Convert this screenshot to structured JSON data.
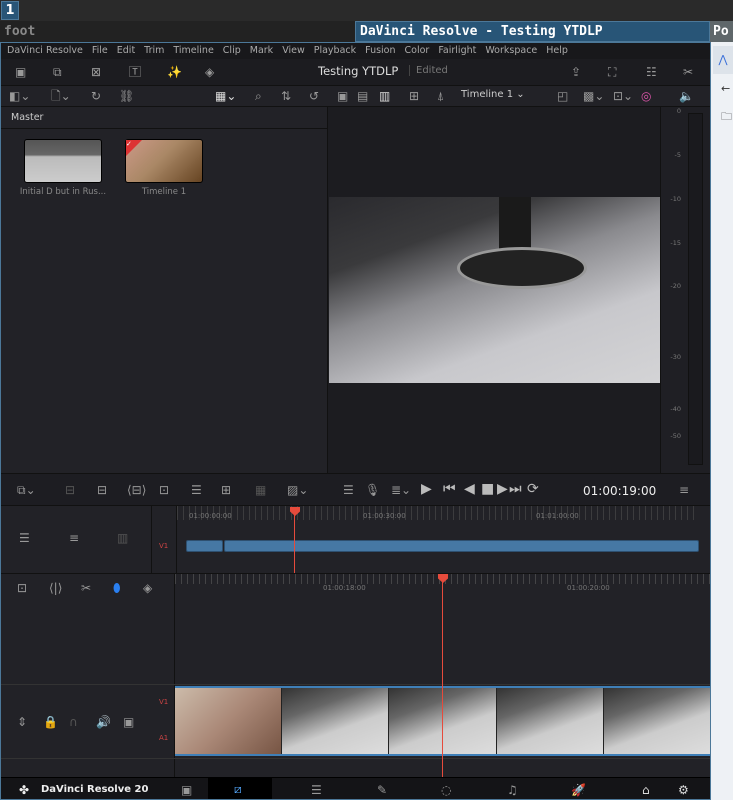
{
  "workspace": {
    "number": "1"
  },
  "titles": {
    "left": "foot",
    "main": "DaVinci Resolve - Testing YTDLP",
    "right": "Po"
  },
  "menu": [
    "DaVinci Resolve",
    "File",
    "Edit",
    "Trim",
    "Timeline",
    "Clip",
    "Mark",
    "View",
    "Playback",
    "Fusion",
    "Color",
    "Fairlight",
    "Workspace",
    "Help"
  ],
  "project": {
    "title": "Testing YTDLP",
    "status": "Edited"
  },
  "viewer": {
    "timeline_select": "Timeline 1",
    "timecode": "01:00:19:00"
  },
  "pool": {
    "bin": "Master",
    "clips": [
      {
        "name": "Initial D but in Rus..."
      },
      {
        "name": "Timeline 1"
      }
    ]
  },
  "meter": {
    "ticks": [
      "0",
      "-5",
      "-10",
      "-15",
      "-20",
      "-30",
      "-40",
      "-50"
    ]
  },
  "upper_timeline": {
    "ticks": [
      "01:00:00:00",
      "01:00:30:00",
      "01:01:00:00"
    ],
    "track": "V1",
    "playhead_fraction": 0.21
  },
  "lower_timeline": {
    "ticks": [
      "01:00:18:00",
      "01:00:20:00"
    ],
    "video_track": "V1",
    "audio_track": "A1"
  },
  "footer": {
    "app": "DaVinci Resolve 20",
    "active_page": "cut"
  },
  "colors": {
    "accent": "#e64b3c",
    "clip": "#4678a4",
    "focus": "#285577"
  }
}
